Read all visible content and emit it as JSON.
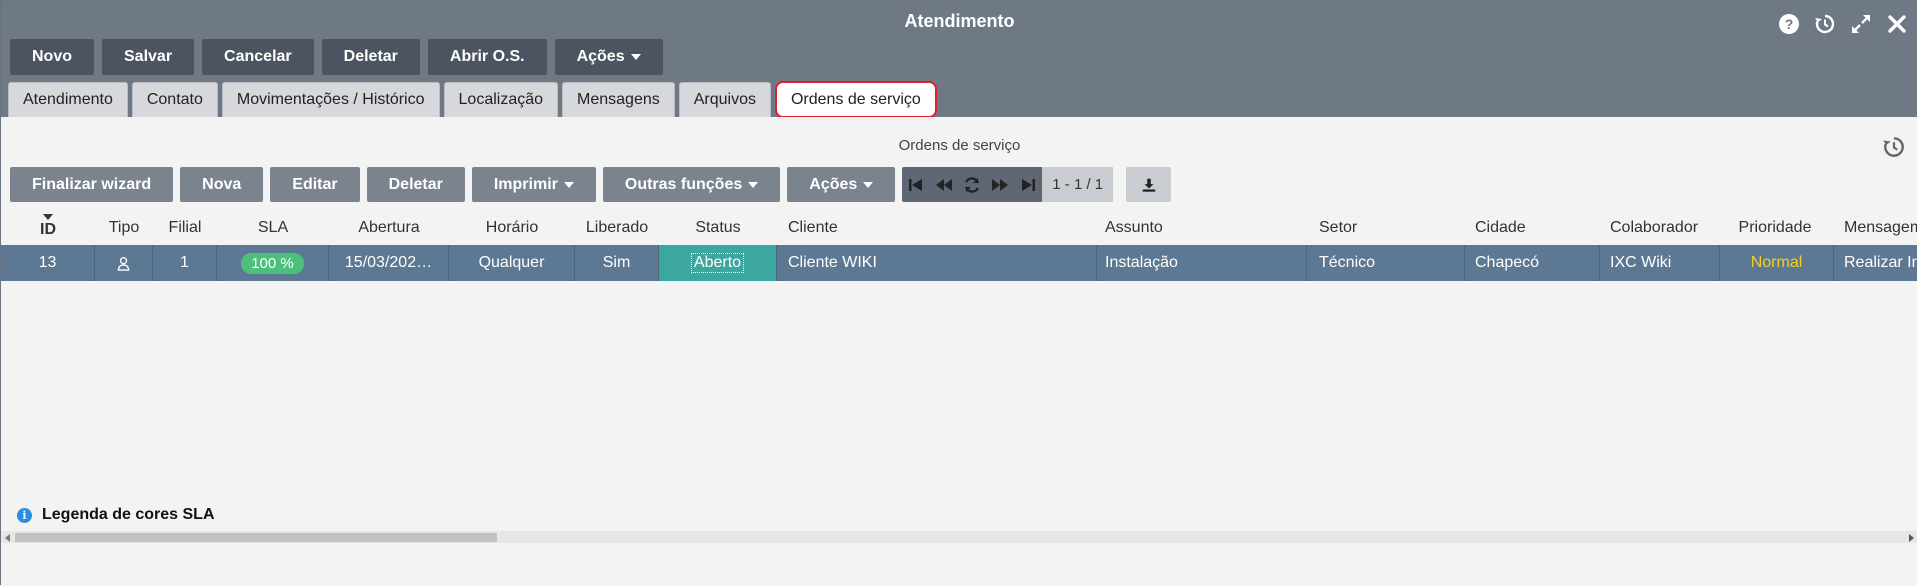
{
  "window": {
    "title": "Atendimento"
  },
  "toolbar": {
    "buttons": [
      "Novo",
      "Salvar",
      "Cancelar",
      "Deletar",
      "Abrir O.S.",
      "Ações"
    ]
  },
  "tabs": [
    "Atendimento",
    "Contato",
    "Movimentações / Histórico",
    "Localização",
    "Mensagens",
    "Arquivos",
    "Ordens de serviço"
  ],
  "active_tab": "Ordens de serviço",
  "section": {
    "title": "Ordens de serviço"
  },
  "subtoolbar": {
    "finalizar": "Finalizar wizard",
    "nova": "Nova",
    "editar": "Editar",
    "deletar": "Deletar",
    "imprimir": "Imprimir",
    "outras": "Outras funções",
    "acoes": "Ações",
    "pager_info": "1 - 1 / 1"
  },
  "grid": {
    "columns": [
      "ID",
      "Tipo",
      "Filial",
      "SLA",
      "Abertura",
      "Horário",
      "Liberado",
      "Status",
      "Cliente",
      "Assunto",
      "Setor",
      "Cidade",
      "Colaborador",
      "Prioridade",
      "Mensagem"
    ],
    "rows": [
      {
        "id": "13",
        "tipo_icon": "user-icon",
        "filial": "1",
        "sla": "100 %",
        "abertura": "15/03/202…",
        "horario": "Qualquer",
        "liberado": "Sim",
        "status": "Aberto",
        "cliente": "Cliente WIKI",
        "assunto": "Instalação",
        "setor": "Técnico",
        "cidade": "Chapecó",
        "colaborador": "IXC Wiki",
        "prioridade": "Normal",
        "mensagem": "Realizar In"
      }
    ]
  },
  "legend": {
    "label": "Legenda de cores SLA"
  },
  "colors": {
    "title_bar": "#6f7985",
    "row_selected": "#5d7893",
    "status_open": "#3ca79f",
    "sla_badge": "#4cc07a",
    "priority_normal": "#f5d020",
    "active_tab_border": "#e0202a"
  }
}
